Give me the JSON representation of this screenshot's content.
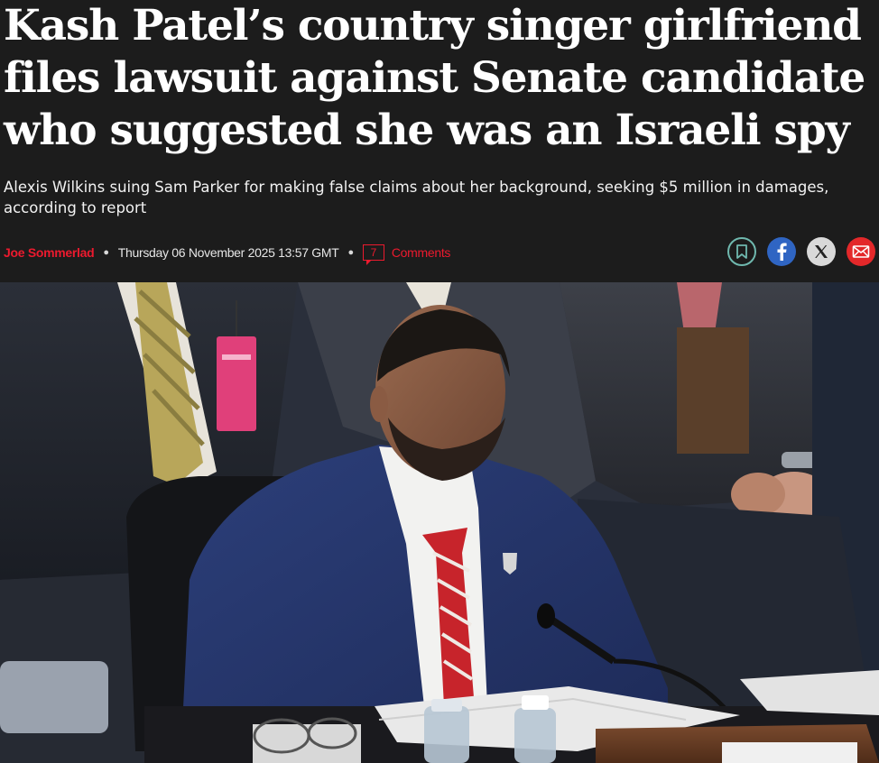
{
  "article": {
    "headline": "Kash Patel’s country singer girlfriend files lawsuit against Senate candidate who suggested she was an Israeli spy",
    "standfirst": "Alexis Wilkins suing Sam Parker for making false claims about her background, seeking $5 million in damages, according to report",
    "author": "Joe Sommerlad",
    "date": "Thursday 06 November 2025 13:57 GMT",
    "comment_count": "7",
    "comments_label": "Comments"
  },
  "share": {
    "icons": [
      "bookmark-icon",
      "facebook-icon",
      "x-icon",
      "email-icon"
    ],
    "colors": {
      "bookmark": "#6fb8ae",
      "facebook": "#2f65c3",
      "x": "#d9d9d9",
      "email": "#e3282a"
    }
  },
  "photo": {
    "desc_icons": [
      "water-bottle",
      "microphone"
    ]
  },
  "colors": {
    "background": "#1c1c1c",
    "accent": "#ec1a2e"
  }
}
